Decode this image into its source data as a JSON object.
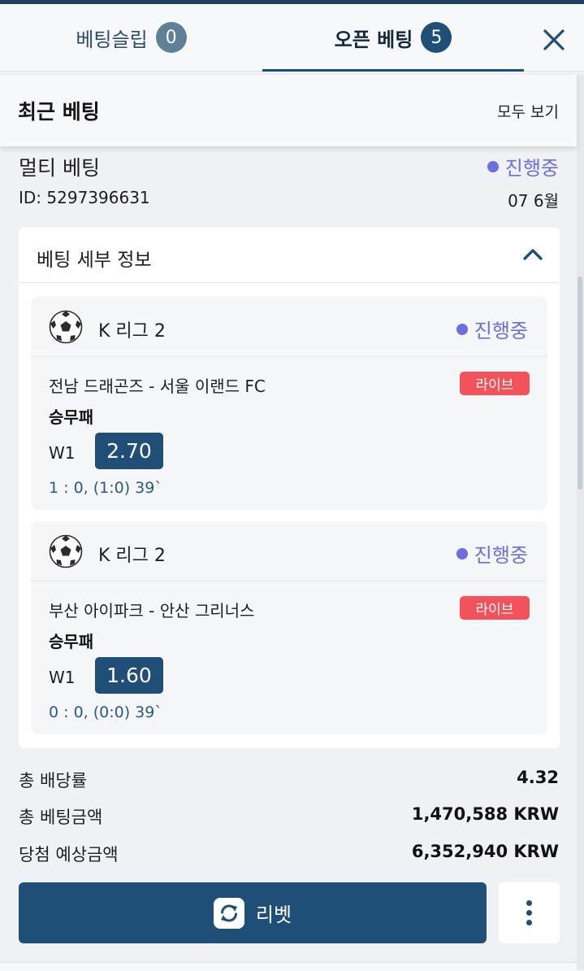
{
  "tabs": {
    "betslip": {
      "label": "베팅슬립",
      "count": "0"
    },
    "open_bets": {
      "label": "오픈 베팅",
      "count": "5"
    }
  },
  "recent": {
    "title": "최근 베팅",
    "see_all": "모두 보기"
  },
  "bet": {
    "type": "멀티 베팅",
    "status": "진행중",
    "id": "ID: 5297396631",
    "date": "07 6월",
    "details_title": "베팅 세부 정보",
    "events": [
      {
        "league": "K 리그 2",
        "status": "진행중",
        "match": "전남 드래곤즈 - 서울 이랜드 FC",
        "live": "라이브",
        "market": "승무패",
        "pick": "W1",
        "odds": "2.70",
        "score": "1 : 0, (1:0) 39`"
      },
      {
        "league": "K 리그 2",
        "status": "진행중",
        "match": "부산 아이파크 - 안산 그리너스",
        "live": "라이브",
        "market": "승무패",
        "pick": "W1",
        "odds": "1.60",
        "score": "0 : 0, (0:0) 39`"
      }
    ],
    "summary": {
      "total_odds_label": "총 배당률",
      "total_odds": "4.32",
      "stake_label": "총 베팅금액",
      "stake": "1,470,588 KRW",
      "potential_label": "당첨 예상금액",
      "potential": "6,352,940 KRW"
    },
    "rebet_label": "리벳"
  },
  "icons": {
    "close": "close-icon",
    "collapse": "chevron-up-icon",
    "sport": "soccer-ball-icon",
    "rebet": "refresh-icon",
    "more": "more-vertical-icon"
  },
  "colors": {
    "brand": "#1f4f77",
    "status": "#6b6fe0",
    "live": "#f2525a"
  }
}
